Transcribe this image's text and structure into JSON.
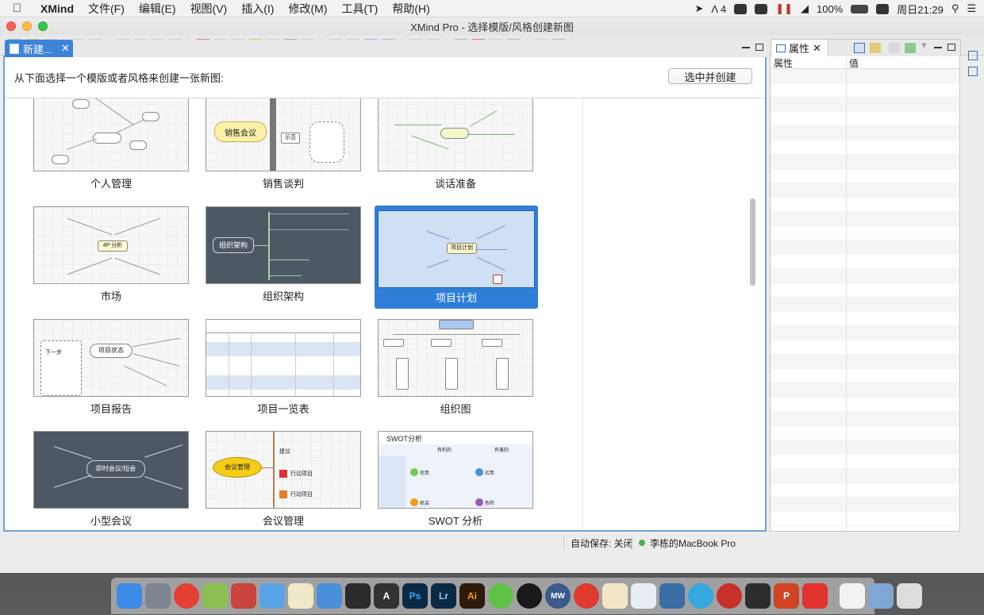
{
  "menubar": {
    "app": "XMind",
    "items": [
      "文件(F)",
      "编辑(E)",
      "视图(V)",
      "插入(I)",
      "修改(M)",
      "工具(T)",
      "帮助(H)"
    ],
    "battery": "100%",
    "clock": "周日21:29",
    "badge_count": "4"
  },
  "window": {
    "title": "XMind Pro - 选择模版/风格创建新图"
  },
  "editor": {
    "tab_label": "新建...",
    "prompt": "从下面选择一个模版或者风格来创建一张新图:",
    "create_button": "选中并创建",
    "templates": [
      {
        "label": "个人管理"
      },
      {
        "label": "销售谈判"
      },
      {
        "label": "谈话准备"
      },
      {
        "label": "市场"
      },
      {
        "label": "组织架构"
      },
      {
        "label": "项目计划",
        "selected": true
      },
      {
        "label": "项目报告"
      },
      {
        "label": "项目一览表"
      },
      {
        "label": "组织图"
      },
      {
        "label": "小型会议"
      },
      {
        "label": "会议管理"
      },
      {
        "label": "SWOT 分析"
      }
    ],
    "thumb_text": {
      "sales": "销售会议",
      "sales_show": "示范",
      "org_center": "组织架构",
      "project_center": "项目计划",
      "report_center": "项目状态",
      "report_next": "下一步",
      "meeting_center": "即时会议/短会",
      "meeting_mgmt": "会议管理",
      "meeting_suggest": "建议",
      "meeting_action1": "行动项目",
      "meeting_action2": "行动项目",
      "swot_title": "SWOT分析",
      "swot_good": "有利的",
      "swot_bad": "有害的",
      "swot_strength": "优势",
      "swot_weakness": "劣势",
      "swot_opportunity": "机会",
      "swot_threat": "危险",
      "market_center": "4P 分析"
    }
  },
  "properties": {
    "tab_label": "属性",
    "col_property": "属性",
    "col_value": "值"
  },
  "status": {
    "autosave": "自动保存: 关闭",
    "device": "李栋的MacBook Pro"
  },
  "dock": {
    "apps": [
      "finder-icon",
      "launchpad-icon",
      "chrome-icon",
      "android-icon",
      "airship-icon",
      "preview-icon",
      "texteditor-icon",
      "keynote-icon",
      "evernote-icon",
      "a-icon",
      "photoshop-icon",
      "lightroom-icon",
      "illustrator-icon",
      "wechat-icon",
      "qq-icon",
      "mw-icon",
      "netease-icon",
      "pen-icon",
      "system-monitor-icon",
      "screen-icon",
      "telegram-icon",
      "xmind-icon",
      "screenshot-icon",
      "powerpoint-icon",
      "xmind-x-icon",
      "docs-icon",
      "notes-icon",
      "trash-icon"
    ],
    "labels": {
      "a": "A",
      "ps": "Ps",
      "lr": "Lr",
      "ai": "Ai",
      "mw": "MW",
      "ppt": "P"
    }
  }
}
